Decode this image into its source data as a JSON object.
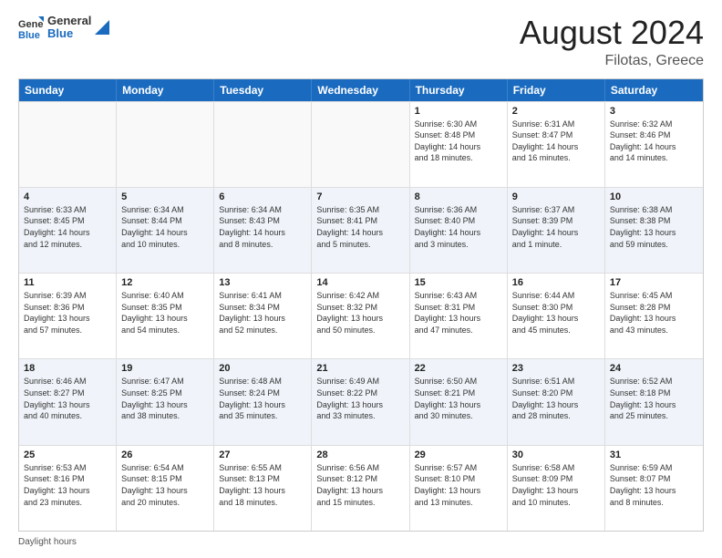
{
  "logo": {
    "general": "General",
    "blue": "Blue"
  },
  "title": {
    "month_year": "August 2024",
    "location": "Filotas, Greece"
  },
  "header_days": [
    "Sunday",
    "Monday",
    "Tuesday",
    "Wednesday",
    "Thursday",
    "Friday",
    "Saturday"
  ],
  "weeks": [
    {
      "alt": false,
      "days": [
        {
          "num": "",
          "lines": [],
          "empty": true
        },
        {
          "num": "",
          "lines": [],
          "empty": true
        },
        {
          "num": "",
          "lines": [],
          "empty": true
        },
        {
          "num": "",
          "lines": [],
          "empty": true
        },
        {
          "num": "1",
          "lines": [
            "Sunrise: 6:30 AM",
            "Sunset: 8:48 PM",
            "Daylight: 14 hours",
            "and 18 minutes."
          ],
          "empty": false
        },
        {
          "num": "2",
          "lines": [
            "Sunrise: 6:31 AM",
            "Sunset: 8:47 PM",
            "Daylight: 14 hours",
            "and 16 minutes."
          ],
          "empty": false
        },
        {
          "num": "3",
          "lines": [
            "Sunrise: 6:32 AM",
            "Sunset: 8:46 PM",
            "Daylight: 14 hours",
            "and 14 minutes."
          ],
          "empty": false
        }
      ]
    },
    {
      "alt": true,
      "days": [
        {
          "num": "4",
          "lines": [
            "Sunrise: 6:33 AM",
            "Sunset: 8:45 PM",
            "Daylight: 14 hours",
            "and 12 minutes."
          ],
          "empty": false
        },
        {
          "num": "5",
          "lines": [
            "Sunrise: 6:34 AM",
            "Sunset: 8:44 PM",
            "Daylight: 14 hours",
            "and 10 minutes."
          ],
          "empty": false
        },
        {
          "num": "6",
          "lines": [
            "Sunrise: 6:34 AM",
            "Sunset: 8:43 PM",
            "Daylight: 14 hours",
            "and 8 minutes."
          ],
          "empty": false
        },
        {
          "num": "7",
          "lines": [
            "Sunrise: 6:35 AM",
            "Sunset: 8:41 PM",
            "Daylight: 14 hours",
            "and 5 minutes."
          ],
          "empty": false
        },
        {
          "num": "8",
          "lines": [
            "Sunrise: 6:36 AM",
            "Sunset: 8:40 PM",
            "Daylight: 14 hours",
            "and 3 minutes."
          ],
          "empty": false
        },
        {
          "num": "9",
          "lines": [
            "Sunrise: 6:37 AM",
            "Sunset: 8:39 PM",
            "Daylight: 14 hours",
            "and 1 minute."
          ],
          "empty": false
        },
        {
          "num": "10",
          "lines": [
            "Sunrise: 6:38 AM",
            "Sunset: 8:38 PM",
            "Daylight: 13 hours",
            "and 59 minutes."
          ],
          "empty": false
        }
      ]
    },
    {
      "alt": false,
      "days": [
        {
          "num": "11",
          "lines": [
            "Sunrise: 6:39 AM",
            "Sunset: 8:36 PM",
            "Daylight: 13 hours",
            "and 57 minutes."
          ],
          "empty": false
        },
        {
          "num": "12",
          "lines": [
            "Sunrise: 6:40 AM",
            "Sunset: 8:35 PM",
            "Daylight: 13 hours",
            "and 54 minutes."
          ],
          "empty": false
        },
        {
          "num": "13",
          "lines": [
            "Sunrise: 6:41 AM",
            "Sunset: 8:34 PM",
            "Daylight: 13 hours",
            "and 52 minutes."
          ],
          "empty": false
        },
        {
          "num": "14",
          "lines": [
            "Sunrise: 6:42 AM",
            "Sunset: 8:32 PM",
            "Daylight: 13 hours",
            "and 50 minutes."
          ],
          "empty": false
        },
        {
          "num": "15",
          "lines": [
            "Sunrise: 6:43 AM",
            "Sunset: 8:31 PM",
            "Daylight: 13 hours",
            "and 47 minutes."
          ],
          "empty": false
        },
        {
          "num": "16",
          "lines": [
            "Sunrise: 6:44 AM",
            "Sunset: 8:30 PM",
            "Daylight: 13 hours",
            "and 45 minutes."
          ],
          "empty": false
        },
        {
          "num": "17",
          "lines": [
            "Sunrise: 6:45 AM",
            "Sunset: 8:28 PM",
            "Daylight: 13 hours",
            "and 43 minutes."
          ],
          "empty": false
        }
      ]
    },
    {
      "alt": true,
      "days": [
        {
          "num": "18",
          "lines": [
            "Sunrise: 6:46 AM",
            "Sunset: 8:27 PM",
            "Daylight: 13 hours",
            "and 40 minutes."
          ],
          "empty": false
        },
        {
          "num": "19",
          "lines": [
            "Sunrise: 6:47 AM",
            "Sunset: 8:25 PM",
            "Daylight: 13 hours",
            "and 38 minutes."
          ],
          "empty": false
        },
        {
          "num": "20",
          "lines": [
            "Sunrise: 6:48 AM",
            "Sunset: 8:24 PM",
            "Daylight: 13 hours",
            "and 35 minutes."
          ],
          "empty": false
        },
        {
          "num": "21",
          "lines": [
            "Sunrise: 6:49 AM",
            "Sunset: 8:22 PM",
            "Daylight: 13 hours",
            "and 33 minutes."
          ],
          "empty": false
        },
        {
          "num": "22",
          "lines": [
            "Sunrise: 6:50 AM",
            "Sunset: 8:21 PM",
            "Daylight: 13 hours",
            "and 30 minutes."
          ],
          "empty": false
        },
        {
          "num": "23",
          "lines": [
            "Sunrise: 6:51 AM",
            "Sunset: 8:20 PM",
            "Daylight: 13 hours",
            "and 28 minutes."
          ],
          "empty": false
        },
        {
          "num": "24",
          "lines": [
            "Sunrise: 6:52 AM",
            "Sunset: 8:18 PM",
            "Daylight: 13 hours",
            "and 25 minutes."
          ],
          "empty": false
        }
      ]
    },
    {
      "alt": false,
      "days": [
        {
          "num": "25",
          "lines": [
            "Sunrise: 6:53 AM",
            "Sunset: 8:16 PM",
            "Daylight: 13 hours",
            "and 23 minutes."
          ],
          "empty": false
        },
        {
          "num": "26",
          "lines": [
            "Sunrise: 6:54 AM",
            "Sunset: 8:15 PM",
            "Daylight: 13 hours",
            "and 20 minutes."
          ],
          "empty": false
        },
        {
          "num": "27",
          "lines": [
            "Sunrise: 6:55 AM",
            "Sunset: 8:13 PM",
            "Daylight: 13 hours",
            "and 18 minutes."
          ],
          "empty": false
        },
        {
          "num": "28",
          "lines": [
            "Sunrise: 6:56 AM",
            "Sunset: 8:12 PM",
            "Daylight: 13 hours",
            "and 15 minutes."
          ],
          "empty": false
        },
        {
          "num": "29",
          "lines": [
            "Sunrise: 6:57 AM",
            "Sunset: 8:10 PM",
            "Daylight: 13 hours",
            "and 13 minutes."
          ],
          "empty": false
        },
        {
          "num": "30",
          "lines": [
            "Sunrise: 6:58 AM",
            "Sunset: 8:09 PM",
            "Daylight: 13 hours",
            "and 10 minutes."
          ],
          "empty": false
        },
        {
          "num": "31",
          "lines": [
            "Sunrise: 6:59 AM",
            "Sunset: 8:07 PM",
            "Daylight: 13 hours",
            "and 8 minutes."
          ],
          "empty": false
        }
      ]
    }
  ],
  "footer": {
    "note": "Daylight hours"
  }
}
